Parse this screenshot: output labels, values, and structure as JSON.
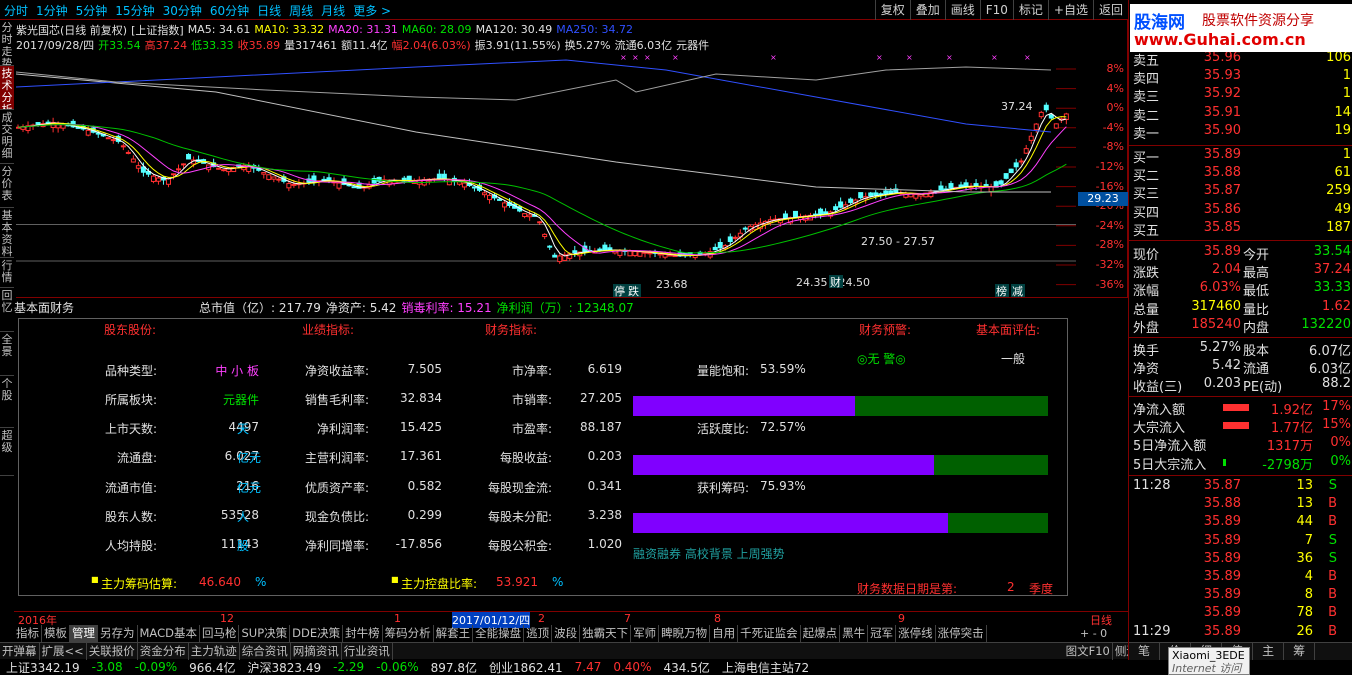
{
  "periods": [
    "分时",
    "1分钟",
    "5分钟",
    "15分钟",
    "30分钟",
    "60分钟",
    "日线",
    "周线",
    "月线",
    "更多 >"
  ],
  "top_buttons": [
    "复权",
    "叠加",
    "画线",
    "F10",
    "标记",
    "+自选",
    "返回"
  ],
  "left_tabs": [
    "分时走势",
    "技术分析",
    "成交明细",
    "分价表",
    "基本资料",
    "行情",
    "回忆",
    "全景",
    "个股",
    "超级"
  ],
  "info": {
    "title": "紫光国芯(日线 前复权)",
    "index": "[上证指数]",
    "ma5": "MA5: 34.61",
    "ma10": "MA10: 33.32",
    "ma20": "MA20: 31.31",
    "ma60": "MA60: 28.09",
    "ma120": "MA120: 30.49",
    "ma250": "MA250: 34.72",
    "date": "2017/09/28/四",
    "open": "开33.54",
    "high": "高37.24",
    "low": "低33.33",
    "close": "收35.89",
    "vol": "量317461",
    "amount": "额11.4亿",
    "chg": "幅2.04(6.03%)",
    "amp": "振3.91(11.55%)",
    "turn": "换5.27%",
    "float": "流通6.03亿",
    "sector": "元器件"
  },
  "chart_data": {
    "type": "line",
    "title": "紫光国芯(日线 前复权)",
    "y_ticks": [
      "8%",
      "4%",
      "0%",
      "-4%",
      "-8%",
      "-12%",
      "-16%",
      "-20%",
      "-24%",
      "-28%",
      "-32%",
      "-36%"
    ],
    "price_tag": "29.23",
    "annotations": [
      "37.24",
      "23.68",
      "24.35 - 24.50",
      "27.50 - 27.57"
    ],
    "markers": [
      "停",
      "跌",
      "财",
      "榜",
      "减"
    ],
    "series": [
      {
        "name": "MA5",
        "color": "#ffffff"
      },
      {
        "name": "MA10",
        "color": "#ffff00"
      },
      {
        "name": "MA20",
        "color": "#ff40ff"
      },
      {
        "name": "MA60",
        "color": "#00c000"
      },
      {
        "name": "MA120",
        "color": "#c0c0c0"
      },
      {
        "name": "MA250",
        "color": "#3050ff"
      }
    ]
  },
  "fin": {
    "header": {
      "title": "基本面财务",
      "mktcap": "总市值（亿）: 217.79",
      "netasset": "净资产: 5.42",
      "netrate": "销毒利率: 15.21",
      "profit": "净利润（万）: 12348.07"
    },
    "sec_titles": [
      "股东股份:",
      "业绩指标:",
      "财务指标:",
      "财务预警:",
      "基本面评估:"
    ],
    "col1": [
      {
        "label": "品种类型:",
        "value": "中 小 板",
        "unit": ""
      },
      {
        "label": "所属板块:",
        "value": "元器件",
        "unit": ""
      },
      {
        "label": "上市天数:",
        "value": "4497",
        "unit": "天"
      },
      {
        "label": "流通盘:",
        "value": "6.027",
        "unit": "亿元"
      },
      {
        "label": "流通市值:",
        "value": "216",
        "unit": "亿元"
      },
      {
        "label": "股东人数:",
        "value": "53528",
        "unit": "人"
      },
      {
        "label": "人均持股:",
        "value": "11143",
        "unit": "股"
      }
    ],
    "col2": [
      {
        "label": "净资收益率:",
        "value": "7.505"
      },
      {
        "label": "销售毛利率:",
        "value": "32.834"
      },
      {
        "label": "净利润率:",
        "value": "15.425"
      },
      {
        "label": "主营利润率:",
        "value": "17.361"
      },
      {
        "label": "优质资产率:",
        "value": "0.582"
      },
      {
        "label": "现金负债比:",
        "value": "0.299"
      },
      {
        "label": "净利同增率:",
        "value": "-17.856"
      }
    ],
    "col3": [
      {
        "label": "市净率:",
        "value": "6.619"
      },
      {
        "label": "市销率:",
        "value": "27.205"
      },
      {
        "label": "市盈率:",
        "value": "88.187"
      },
      {
        "label": "每股收益:",
        "value": "0.203"
      },
      {
        "label": "每股现金流:",
        "value": "0.341"
      },
      {
        "label": "每股未分配:",
        "value": "3.238"
      },
      {
        "label": "每股公积金:",
        "value": "1.020"
      }
    ],
    "warn": "◎无 警◎",
    "eval": "一般",
    "bars": [
      {
        "label": "量能饱和:",
        "value": "53.59%",
        "fraction": 0.5359
      },
      {
        "label": "活跃度比:",
        "value": "72.57%",
        "fraction": 0.7257
      },
      {
        "label": "获利筹码:",
        "value": "75.93%",
        "fraction": 0.7593
      }
    ],
    "tags": "融资融券 高校背景 上周强势",
    "chip_label": "主力筹码估算:",
    "chip_value": "46.640",
    "chip_unit": "%",
    "ctrl_label": "主力控盘比率:",
    "ctrl_value": "53.921",
    "ctrl_unit": "%",
    "report_label": "财务数据日期是第:",
    "report_num": "2",
    "report_unit": "季度"
  },
  "time_axis": {
    "year": "2016年",
    "m12": "12",
    "m1": "1",
    "date": "2017/01/12/四",
    "m2": "2",
    "m7": "7",
    "m8": "8",
    "m9": "9",
    "period": "日线"
  },
  "toolbar": [
    "指标",
    "模板",
    "管理",
    "另存为",
    "MACD基本",
    "回马枪",
    "SUP决策",
    "DDE决策",
    "封牛榜",
    "筹码分析",
    "解套王",
    "全能操盘",
    "逃顶",
    "波段",
    "独霸天下",
    "军师",
    "睥睨万物",
    "自用",
    "千死证监会",
    "起爆点",
    "黑牛",
    "冠军",
    "涨停线",
    "涨停突击"
  ],
  "bottombar": [
    "开弹幕",
    "扩展<<",
    "关联报价",
    "资金分布",
    "主力轨迹",
    "综合资讯",
    "网摘资讯",
    "行业资讯"
  ],
  "bottom_right": [
    "图文F10",
    "侧边栏<"
  ],
  "ticker": {
    "sh": "上证3342.19",
    "sh_chg": "-3.08",
    "sh_pct": "-0.09%",
    "sh_amt": "966.4亿",
    "sz": "沪深3823.49",
    "sz_chg": "-2.29",
    "sz_pct": "-0.06%",
    "sz_amt": "897.8亿",
    "cy": "创业1862.41",
    "cy_chg": "7.47",
    "cy_pct": "0.40%",
    "cy_amt": "434.5亿",
    "srv": "上海电信主站72"
  },
  "watermark": {
    "brand": "股海网",
    "slogan": "股票软件资源分享",
    "url": "www.Guhai.com.cn"
  },
  "tooltip": {
    "title": "Xiaomi_3EDE",
    "sub": "Internet 访问"
  },
  "quote": {
    "asks": [
      {
        "label": "卖五",
        "price": "35.96",
        "vol": "106"
      },
      {
        "label": "卖四",
        "price": "35.93",
        "vol": "1"
      },
      {
        "label": "卖三",
        "price": "35.92",
        "vol": "1"
      },
      {
        "label": "卖二",
        "price": "35.91",
        "vol": "14"
      },
      {
        "label": "卖一",
        "price": "35.90",
        "vol": "19"
      }
    ],
    "bids": [
      {
        "label": "买一",
        "price": "35.89",
        "vol": "1"
      },
      {
        "label": "买二",
        "price": "35.88",
        "vol": "61"
      },
      {
        "label": "买三",
        "price": "35.87",
        "vol": "259"
      },
      {
        "label": "买四",
        "price": "35.86",
        "vol": "49"
      },
      {
        "label": "买五",
        "price": "35.85",
        "vol": "187"
      }
    ],
    "stats": [
      {
        "l1": "现价",
        "v1": "35.89",
        "l2": "今开",
        "v2": "33.54",
        "c1": "r",
        "c2": "g"
      },
      {
        "l1": "涨跌",
        "v1": "2.04",
        "l2": "最高",
        "v2": "37.24",
        "c1": "r",
        "c2": "r"
      },
      {
        "l1": "涨幅",
        "v1": "6.03%",
        "l2": "最低",
        "v2": "33.33",
        "c1": "r",
        "c2": "g"
      },
      {
        "l1": "总量",
        "v1": "317460",
        "l2": "量比",
        "v2": "1.62",
        "c1": "y",
        "c2": "r"
      },
      {
        "l1": "外盘",
        "v1": "185240",
        "l2": "内盘",
        "v2": "132220",
        "c1": "r",
        "c2": "g"
      }
    ],
    "stats2": [
      {
        "l1": "换手",
        "v1": "5.27%",
        "l2": "股本",
        "v2": "6.07亿"
      },
      {
        "l1": "净资",
        "v1": "5.42",
        "l2": "流通",
        "v2": "6.03亿"
      },
      {
        "l1": "收益(三)",
        "v1": "0.203",
        "l2": "PE(动)",
        "v2": "88.2"
      }
    ],
    "flows": [
      {
        "label": "净流入额",
        "value": "1.92亿",
        "pct": "17%",
        "c": "r",
        "bar": "r"
      },
      {
        "label": "大宗流入",
        "value": "1.77亿",
        "pct": "15%",
        "c": "r",
        "bar": "r"
      },
      {
        "label": "5日净流入额",
        "value": "1317万",
        "pct": "0%",
        "c": "r",
        "bar": ""
      },
      {
        "label": "5日大宗流入",
        "value": "-2798万",
        "pct": "0%",
        "c": "g",
        "bar": "g"
      }
    ],
    "ticks": [
      {
        "t": "11:28",
        "p": "35.87",
        "v": "13",
        "s": "S"
      },
      {
        "t": "",
        "p": "35.88",
        "v": "13",
        "s": "B"
      },
      {
        "t": "",
        "p": "35.89",
        "v": "44",
        "s": "B"
      },
      {
        "t": "",
        "p": "35.89",
        "v": "7",
        "s": "S"
      },
      {
        "t": "",
        "p": "35.89",
        "v": "36",
        "s": "S"
      },
      {
        "t": "",
        "p": "35.89",
        "v": "4",
        "s": "B"
      },
      {
        "t": "",
        "p": "35.89",
        "v": "8",
        "s": "B"
      },
      {
        "t": "",
        "p": "35.89",
        "v": "78",
        "s": "B"
      },
      {
        "t": "11:29",
        "p": "35.89",
        "v": "26",
        "s": "B"
      }
    ],
    "bottom_tabs": [
      "笔",
      "价",
      "细",
      "值",
      "主",
      "筹"
    ]
  }
}
